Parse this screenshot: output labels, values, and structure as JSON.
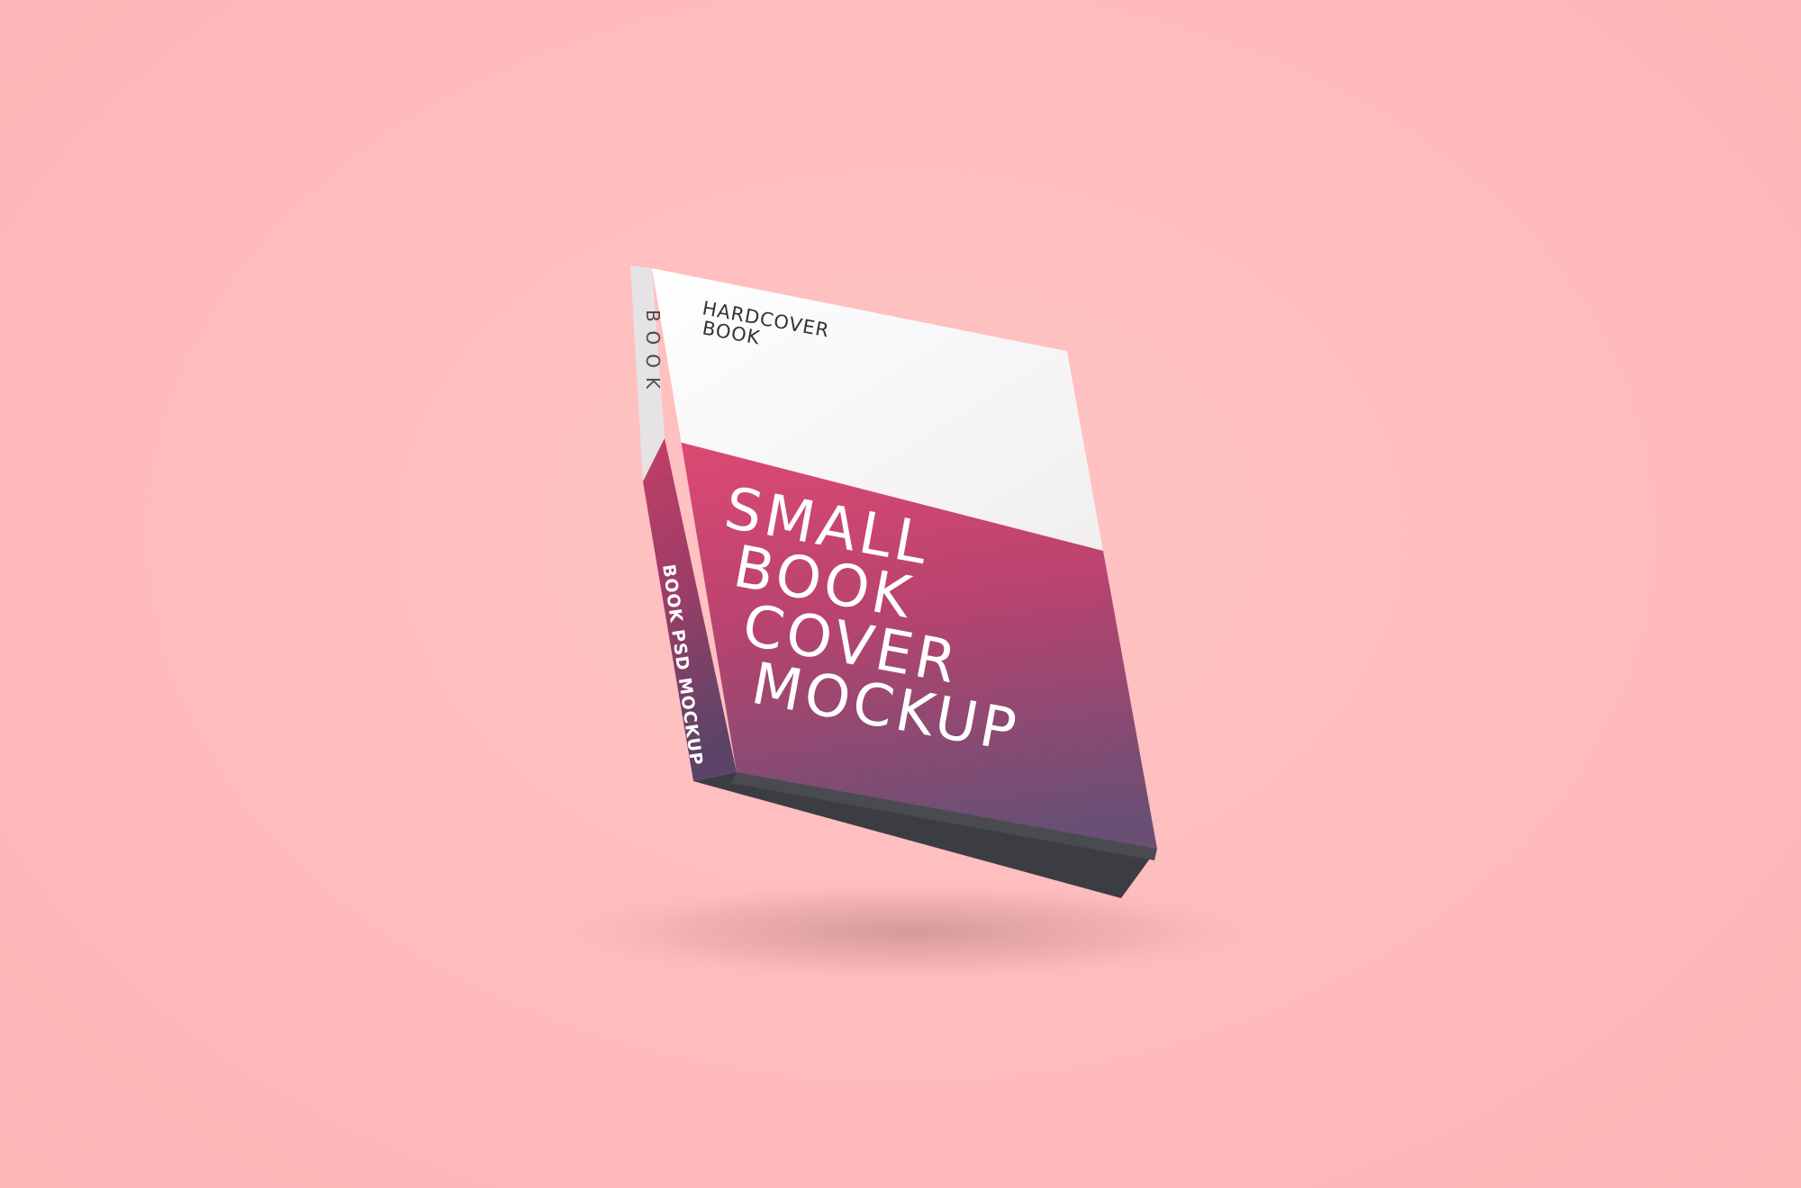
{
  "background_color": "#ffbcbd",
  "book": {
    "top_label_line1": "HARDCOVER",
    "top_label_line2": "BOOK",
    "spine_top_text": "BOOK",
    "spine_bottom_text": "BOOK PSD MOCKUP",
    "title_lines": [
      "SMALL",
      "BOOK",
      "COVER",
      "MOCKUP"
    ],
    "colors": {
      "cover_white": "#f7f4f4",
      "cover_gradient_top": "#dd4a73",
      "cover_gradient_mid": "#b9436f",
      "cover_gradient_bottom": "#6a4f74",
      "page_block": "#3e3f44",
      "spine_white": "#e4e2e3"
    }
  }
}
